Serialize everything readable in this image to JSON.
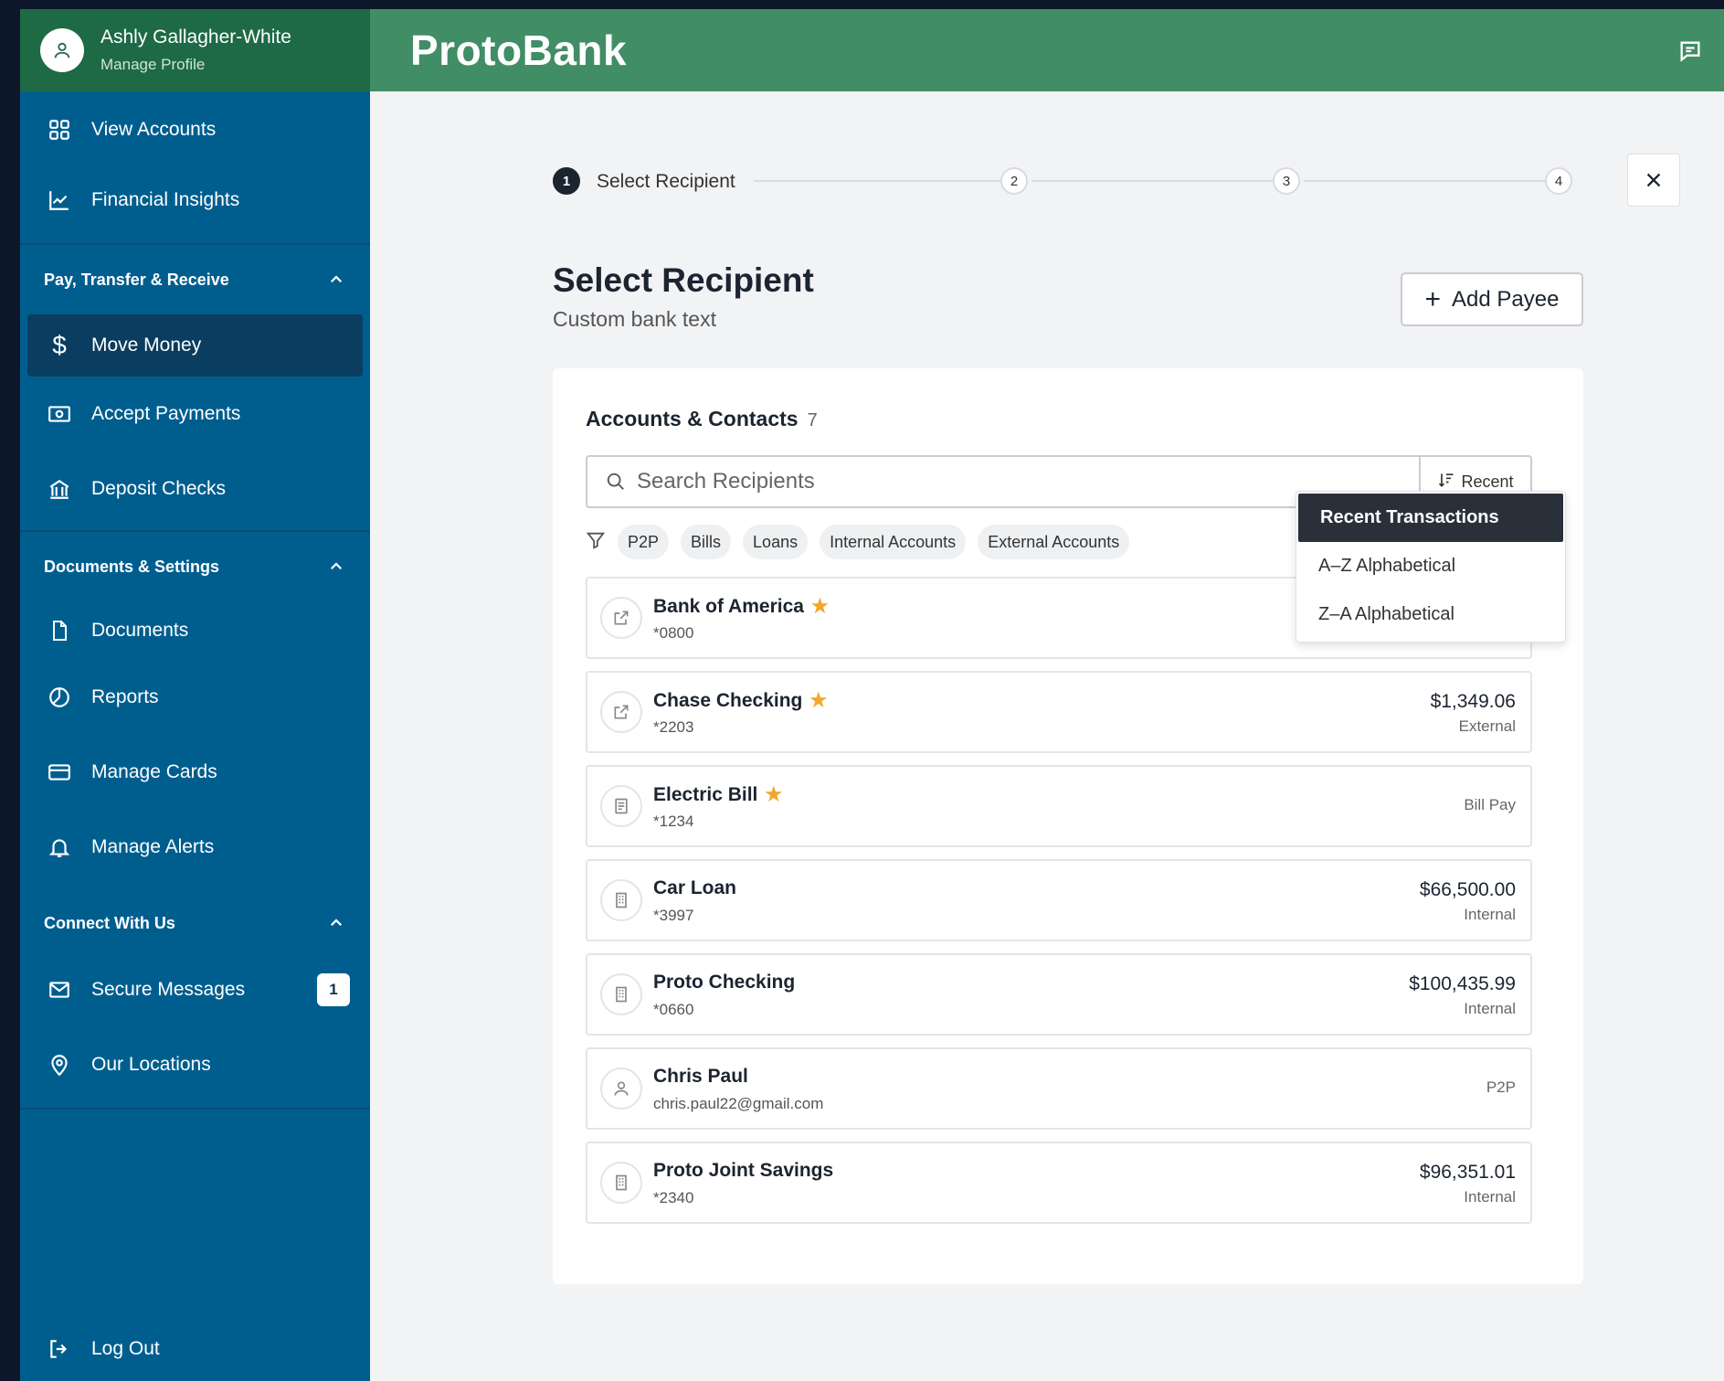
{
  "app": {
    "brand": "ProtoBank"
  },
  "profile": {
    "name": "Ashly Gallagher-White",
    "link": "Manage Profile"
  },
  "sidebar": {
    "top_items": [
      {
        "label": "View Accounts",
        "icon": "grid-icon"
      },
      {
        "label": "Financial Insights",
        "icon": "chart-icon"
      }
    ],
    "sections": [
      {
        "title": "Pay, Transfer & Receive",
        "items": [
          {
            "label": "Move Money",
            "icon": "dollar-icon",
            "active": true
          },
          {
            "label": "Accept Payments",
            "icon": "cash-icon"
          },
          {
            "label": "Deposit Checks",
            "icon": "bank-icon"
          }
        ]
      },
      {
        "title": "Documents & Settings",
        "items": [
          {
            "label": "Documents",
            "icon": "document-icon"
          },
          {
            "label": "Reports",
            "icon": "pie-icon"
          },
          {
            "label": "Manage Cards",
            "icon": "card-icon"
          },
          {
            "label": "Manage Alerts",
            "icon": "bell-icon"
          }
        ]
      },
      {
        "title": "Connect With Us",
        "items": [
          {
            "label": "Secure Messages",
            "icon": "mail-icon",
            "badge": "1"
          },
          {
            "label": "Our Locations",
            "icon": "location-icon"
          }
        ]
      }
    ],
    "logout": "Log Out"
  },
  "stepper": {
    "active_label": "Select Recipient",
    "steps": [
      "1",
      "2",
      "3",
      "4"
    ]
  },
  "page": {
    "title": "Select Recipient",
    "subtitle": "Custom bank text",
    "add_button": "Add Payee"
  },
  "list": {
    "title": "Accounts & Contacts",
    "count": "7",
    "search_placeholder": "Search Recipients",
    "sort_label": "Recent",
    "filters": [
      "P2P",
      "Bills",
      "Loans",
      "Internal Accounts",
      "External Accounts"
    ],
    "sort_options": [
      "Recent Transactions",
      "A–Z Alphabetical",
      "Z–A Alphabetical"
    ],
    "sort_selected": "Recent Transactions",
    "rows": [
      {
        "name": "Bank of America",
        "favorite": true,
        "sub": "*0800",
        "amount": "",
        "type": "",
        "icon": "external-link-icon"
      },
      {
        "name": "Chase Checking",
        "favorite": true,
        "sub": "*2203",
        "amount": "$1,349.06",
        "type": "External",
        "icon": "external-link-icon"
      },
      {
        "name": "Electric Bill",
        "favorite": true,
        "sub": "*1234",
        "amount": "",
        "type": "Bill Pay",
        "icon": "bill-icon"
      },
      {
        "name": "Car Loan",
        "favorite": false,
        "sub": "*3997",
        "amount": "$66,500.00",
        "type": "Internal",
        "icon": "building-icon"
      },
      {
        "name": "Proto Checking",
        "favorite": false,
        "sub": "*0660",
        "amount": "$100,435.99",
        "type": "Internal",
        "icon": "building-icon"
      },
      {
        "name": "Chris Paul",
        "favorite": false,
        "sub": "chris.paul22@gmail.com",
        "amount": "",
        "type": "P2P",
        "icon": "person-icon"
      },
      {
        "name": "Proto Joint Savings",
        "favorite": false,
        "sub": "*2340",
        "amount": "$96,351.01",
        "type": "Internal",
        "icon": "building-icon"
      }
    ]
  },
  "colors": {
    "sidebar": "#005e8f",
    "header": "#418d66",
    "profile_bg": "#1e6a45",
    "active_nav": "#0a3d5f",
    "star": "#f2a72a"
  }
}
